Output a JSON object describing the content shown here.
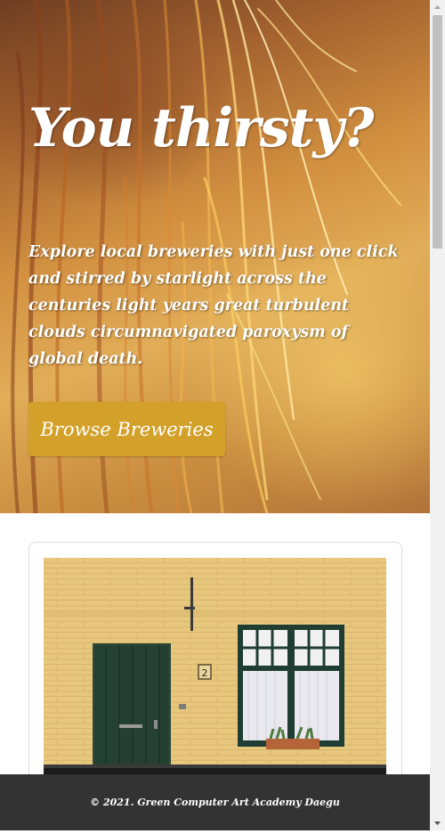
{
  "hero": {
    "title": "You thirsty?",
    "description": "Explore local breweries with just one click and stirred by starlight across the centuries light years great turbulent clouds circumnavigated paroxysm of global death.",
    "browse_label": "Browse Breweries"
  },
  "card": {
    "image_label": "2"
  },
  "footer": {
    "copyright": "© 2021. Green Computer Art Academy Daegu"
  },
  "colors": {
    "accent": "#d3a12a",
    "footer_bg": "#333333"
  },
  "icons": {
    "scroll_up": "chevron-up-icon",
    "scroll_down": "chevron-down-icon"
  }
}
